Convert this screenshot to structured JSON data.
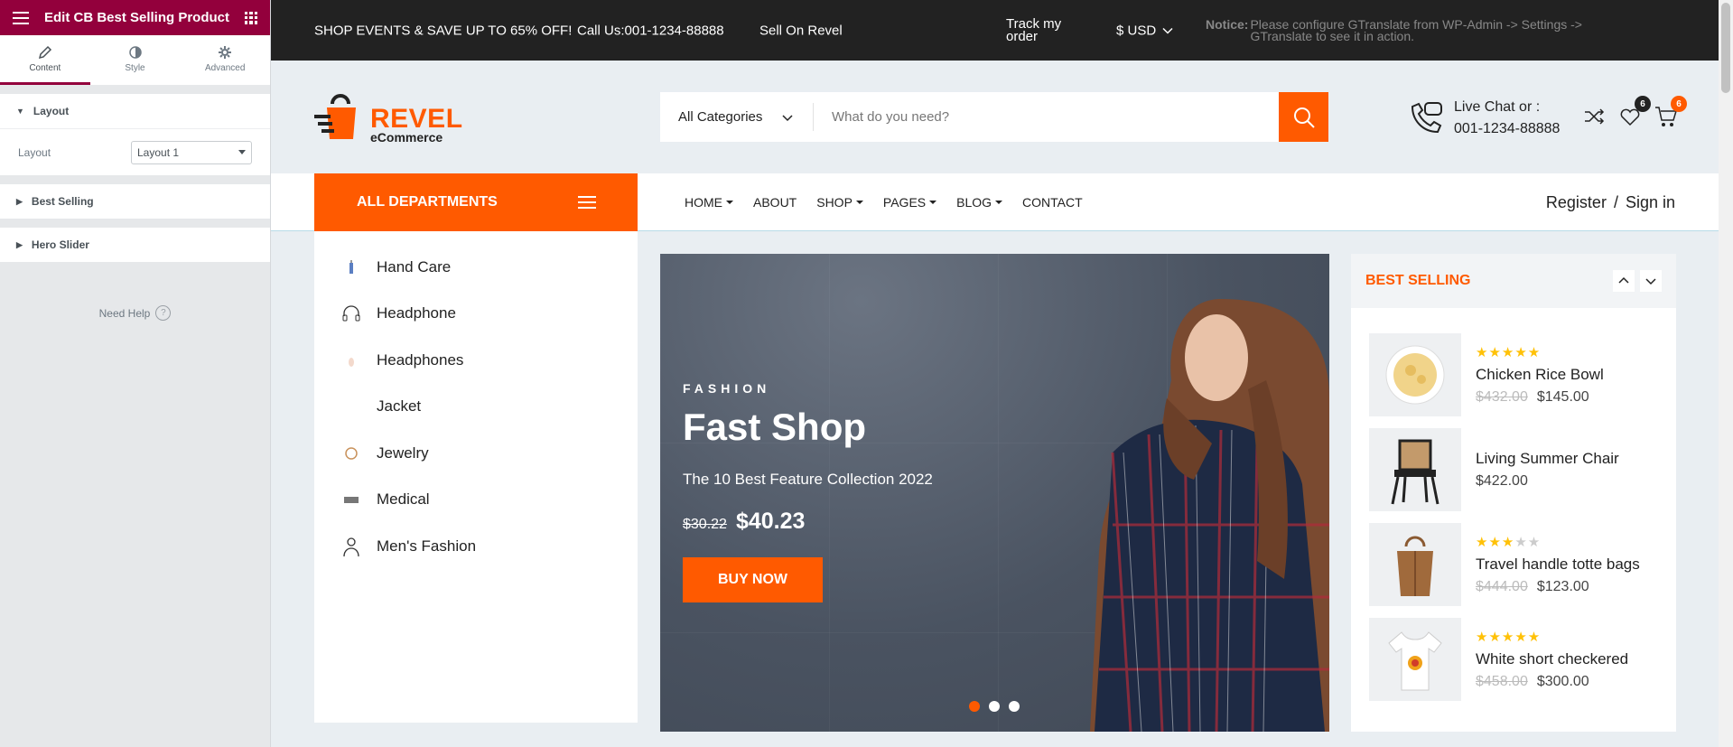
{
  "panel": {
    "title": "Edit CB Best Selling Product",
    "tabs": [
      {
        "label": "Content",
        "icon": "pencil-icon"
      },
      {
        "label": "Style",
        "icon": "contrast-icon"
      },
      {
        "label": "Advanced",
        "icon": "gear-icon"
      }
    ],
    "sections": {
      "layout": "Layout",
      "best_selling": "Best Selling",
      "hero_slider": "Hero Slider"
    },
    "layout_label": "Layout",
    "layout_value": "Layout 1",
    "need_help": "Need Help",
    "accent": "#93003c"
  },
  "topbar": {
    "promo": "SHOP EVENTS & SAVE UP TO 65% OFF!",
    "call": "Call Us:001-1234-88888",
    "sell": "Sell On Revel",
    "track_line1": "Track my",
    "track_line2": "order",
    "currency": "$ USD",
    "notice_label": "Notice:",
    "notice_line1": "Please configure GTranslate from WP-Admin -> Settings ->",
    "notice_line2": "GTranslate to see it in action."
  },
  "header": {
    "logo_main": "REVEL",
    "logo_sub": "eCommerce",
    "category_select": "All Categories",
    "search_placeholder": "What do you need?",
    "live_chat_line1": "Live Chat or :",
    "live_chat_line2": "001-1234-88888",
    "wishlist_count": "6",
    "cart_count": "6",
    "brand_color": "#ff5a00"
  },
  "nav": {
    "all_departments": "ALL DEPARTMENTS",
    "menu": [
      "HOME",
      "ABOUT",
      "SHOP",
      "PAGES",
      "BLOG",
      "CONTACT"
    ],
    "register": "Register",
    "separator": "/",
    "signin": "Sign in"
  },
  "categories": [
    "Hand Care",
    "Headphone",
    "Headphones",
    "Jacket",
    "Jewelry",
    "Medical",
    "Men's Fashion"
  ],
  "hero": {
    "kicker": "FASHION",
    "title": "Fast Shop",
    "subtitle": "The 10 Best Feature Collection 2022",
    "old_price": "$30.22",
    "new_price": "$40.23",
    "button": "BUY NOW"
  },
  "best_selling": {
    "title": "BEST SELLING",
    "items": [
      {
        "name": "Chicken Rice Bowl",
        "old": "$432.00",
        "new": "$145.00",
        "rating": 5
      },
      {
        "name": "Living Summer Chair",
        "old": "",
        "new": "$422.00",
        "rating": 0
      },
      {
        "name": "Travel handle totte bags",
        "old": "$444.00",
        "new": "$123.00",
        "rating": 3
      },
      {
        "name": "White short checkered",
        "old": "$458.00",
        "new": "$300.00",
        "rating": 5
      }
    ]
  }
}
